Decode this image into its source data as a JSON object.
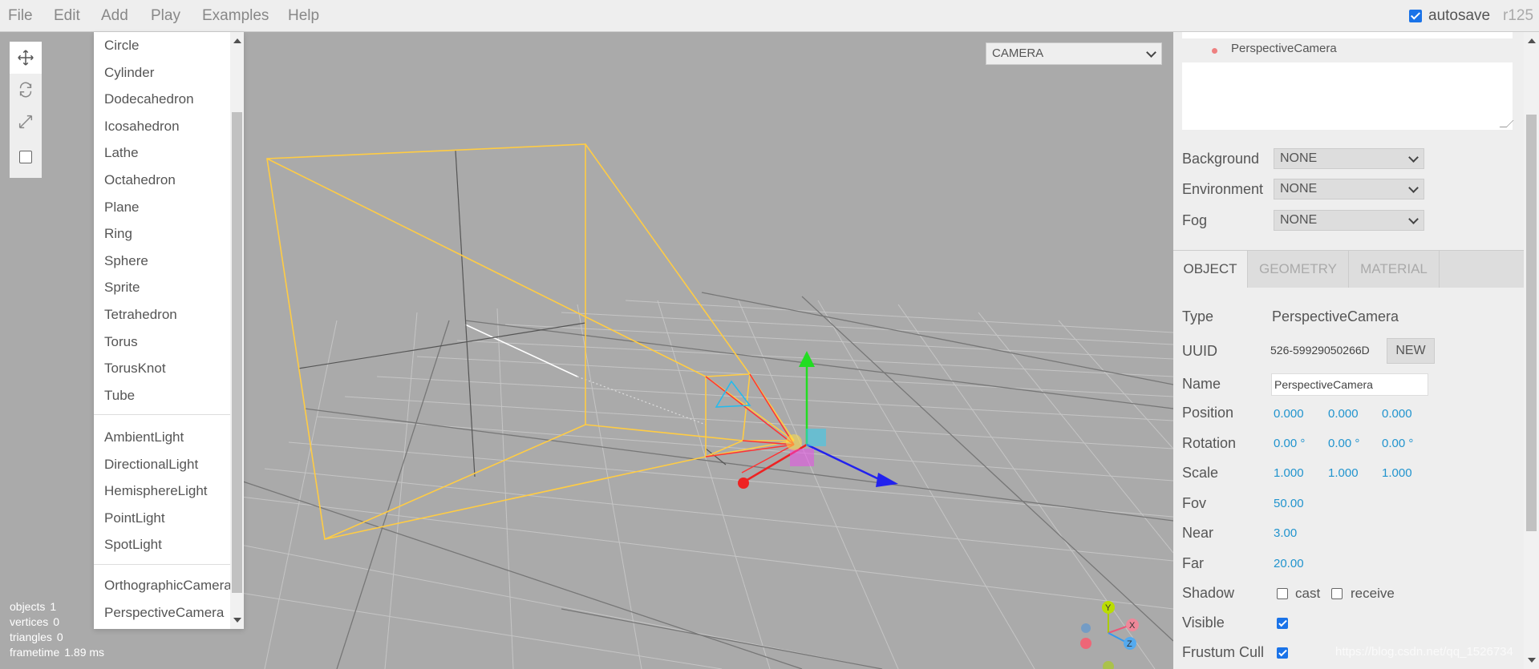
{
  "menubar": {
    "items": [
      "File",
      "Edit",
      "Add",
      "Play",
      "Examples",
      "Help"
    ],
    "autosave_label": "autosave",
    "autosave_checked": true,
    "revision": "r125"
  },
  "add_menu": {
    "geometry_items": [
      "Circle",
      "Cylinder",
      "Dodecahedron",
      "Icosahedron",
      "Lathe",
      "Octahedron",
      "Plane",
      "Ring",
      "Sphere",
      "Sprite",
      "Tetrahedron",
      "Torus",
      "TorusKnot",
      "Tube"
    ],
    "light_items": [
      "AmbientLight",
      "DirectionalLight",
      "HemisphereLight",
      "PointLight",
      "SpotLight"
    ],
    "camera_items": [
      "OrthographicCamera",
      "PerspectiveCamera"
    ]
  },
  "toolbar": {
    "icons": [
      "translate-icon",
      "rotate-icon",
      "scale-icon"
    ]
  },
  "viewport": {
    "camera_select": "CAMERA",
    "info": {
      "objects_label": "objects",
      "objects": "1",
      "vertices_label": "vertices",
      "vertices": "0",
      "triangles_label": "triangles",
      "triangles": "0",
      "frametime_label": "frametime",
      "frametime": "1.89 ms"
    },
    "helper_color": "#ffcc44"
  },
  "sidebar": {
    "outliner": {
      "selected": "PerspectiveCamera"
    },
    "scene": {
      "background_label": "Background",
      "background": "NONE",
      "environment_label": "Environment",
      "environment": "NONE",
      "fog_label": "Fog",
      "fog": "NONE"
    },
    "tabs": [
      "OBJECT",
      "GEOMETRY",
      "MATERIAL"
    ],
    "object": {
      "type_label": "Type",
      "type": "PerspectiveCamera",
      "uuid_label": "UUID",
      "uuid": "526-59929050266D",
      "new_label": "NEW",
      "name_label": "Name",
      "name": "PerspectiveCamera",
      "position_label": "Position",
      "position": [
        "0.000",
        "0.000",
        "0.000"
      ],
      "rotation_label": "Rotation",
      "rotation": [
        "0.00 °",
        "0.00 °",
        "0.00 °"
      ],
      "scale_label": "Scale",
      "scale": [
        "1.000",
        "1.000",
        "1.000"
      ],
      "fov_label": "Fov",
      "fov": "50.00",
      "near_label": "Near",
      "near": "3.00",
      "far_label": "Far",
      "far": "20.00",
      "shadow_label": "Shadow",
      "cast_label": "cast",
      "receive_label": "receive",
      "visible_label": "Visible",
      "frustum_label": "Frustum Cull"
    }
  },
  "watermark": "https://blog.csdn.net/qq_1526734"
}
